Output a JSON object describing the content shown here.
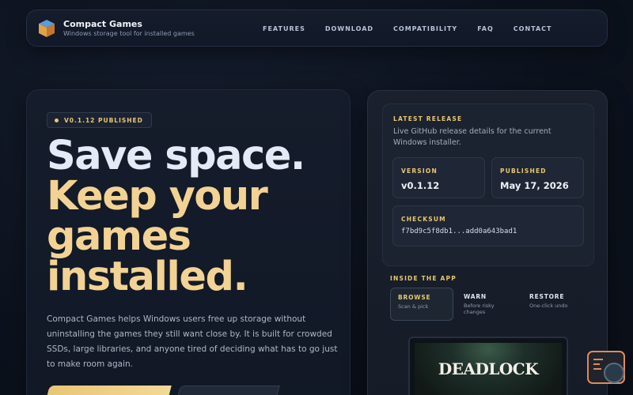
{
  "brand": {
    "name": "Compact Games",
    "tagline": "Windows storage tool for installed games",
    "logo_icon": "cube-logo-icon"
  },
  "nav": {
    "links": [
      "FEATURES",
      "DOWNLOAD",
      "COMPATIBILITY",
      "FAQ",
      "CONTACT"
    ]
  },
  "hero": {
    "badge": "V0.1.12 PUBLISHED",
    "headline_line1": "Save space.",
    "headline_line2": "Keep your",
    "headline_line3": "games",
    "headline_line4": "installed.",
    "description": "Compact Games helps Windows users free up storage without uninstalling the games they still want close by. It is built for crowded SSDs, large libraries, and anyone tired of deciding what has to go just to make room again.",
    "colors": {
      "headline_primary": "#e4eaf6",
      "headline_accent": "#f2d394",
      "badge_accent": "#e8c770"
    }
  },
  "release": {
    "eyebrow": "LATEST RELEASE",
    "description": "Live GitHub release details for the current Windows installer.",
    "version_label": "VERSION",
    "version_value": "v0.1.12",
    "published_label": "PUBLISHED",
    "published_value": "May 17, 2026",
    "checksum_label": "CHECKSUM",
    "checksum_value": "f7bd9c5f8db1...add0a643bad1"
  },
  "app_preview": {
    "eyebrow": "INSIDE THE APP",
    "tabs": [
      {
        "title": "BROWSE",
        "subtitle": "Scan & pick",
        "active": true
      },
      {
        "title": "WARN",
        "subtitle": "Before risky changes",
        "active": false
      },
      {
        "title": "RESTORE",
        "subtitle": "One-click undo",
        "active": false
      }
    ],
    "game_title": "DEADLOCK"
  },
  "floating_widget": {
    "icon": "chat-widget-icon"
  }
}
